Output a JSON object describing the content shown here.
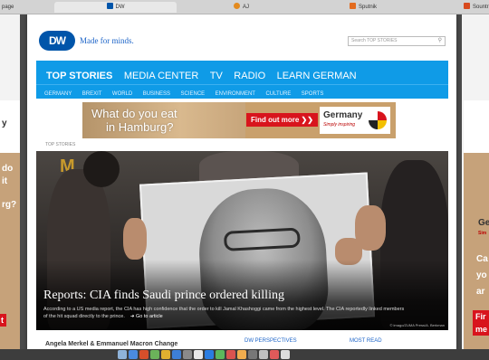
{
  "browser": {
    "tabs": [
      {
        "label": "page",
        "active": false,
        "favicon_color": "#888888"
      },
      {
        "label": "DW",
        "active": true,
        "favicon_color": "#0055aa"
      },
      {
        "label": "AJ",
        "active": false,
        "favicon_color": "#e38a1e"
      },
      {
        "label": "Sputnik",
        "active": false,
        "favicon_color": "#e36b1e"
      },
      {
        "label": "Sountr",
        "active": false,
        "favicon_color": "#d84a1e"
      }
    ]
  },
  "side_ads": {
    "left": {
      "lines": [
        "y",
        "do",
        "it",
        "rg?"
      ],
      "cta": "t"
    },
    "right": {
      "lines": [
        "Ge",
        "Sim"
      ],
      "lines2": [
        "Ca",
        "yo",
        "ar"
      ],
      "cta": "Fir",
      "cta2": "me"
    }
  },
  "header": {
    "logo": "DW",
    "tagline": "Made for minds.",
    "search_placeholder": "Search TOP STORIES"
  },
  "nav": {
    "main": [
      {
        "label": "TOP STORIES",
        "active": true
      },
      {
        "label": "MEDIA CENTER",
        "active": false
      },
      {
        "label": "TV",
        "active": false
      },
      {
        "label": "RADIO",
        "active": false
      },
      {
        "label": "LEARN GERMAN",
        "active": false
      }
    ],
    "sub": [
      "GERMANY",
      "BREXIT",
      "WORLD",
      "BUSINESS",
      "SCIENCE",
      "ENVIRONMENT",
      "CULTURE",
      "SPORTS"
    ]
  },
  "banner": {
    "question_line1": "What do you eat",
    "question_line2": "in Hamburg?",
    "cta": "Find out more ❯❯",
    "brand": "Germany",
    "brand_sub": "Simply inspiring"
  },
  "section_label": "TOP STORIES",
  "hero": {
    "background_letter": "M",
    "headline": "Reports: CIA finds Saudi prince ordered killing",
    "dek": "According to a US media report, the CIA has high confidence that the order to kill Jamal Khashoggi came from the highest level. The CIA reportedly linked members of the hit squad directly to the prince.",
    "go_link": "➜ Go to article",
    "credit": "© imago/ZUMA Press/A. Berkman"
  },
  "below": {
    "left": "Angela Merkel & Emmanuel Macron Change",
    "perspectives": "DW PERSPECTIVES",
    "most_read": "MOST READ"
  },
  "dock": {
    "icon_colors": [
      "#8fb3d9",
      "#4a8be0",
      "#d64f2b",
      "#6bb35a",
      "#e0b030",
      "#3d7fd6",
      "#8a8a8a",
      "#e8e8e8",
      "#2a7de1",
      "#5cb85c",
      "#d9534f",
      "#f0ad4e",
      "#777777",
      "#c0c0c0",
      "#e05a5a",
      "#dcdcdc"
    ]
  }
}
